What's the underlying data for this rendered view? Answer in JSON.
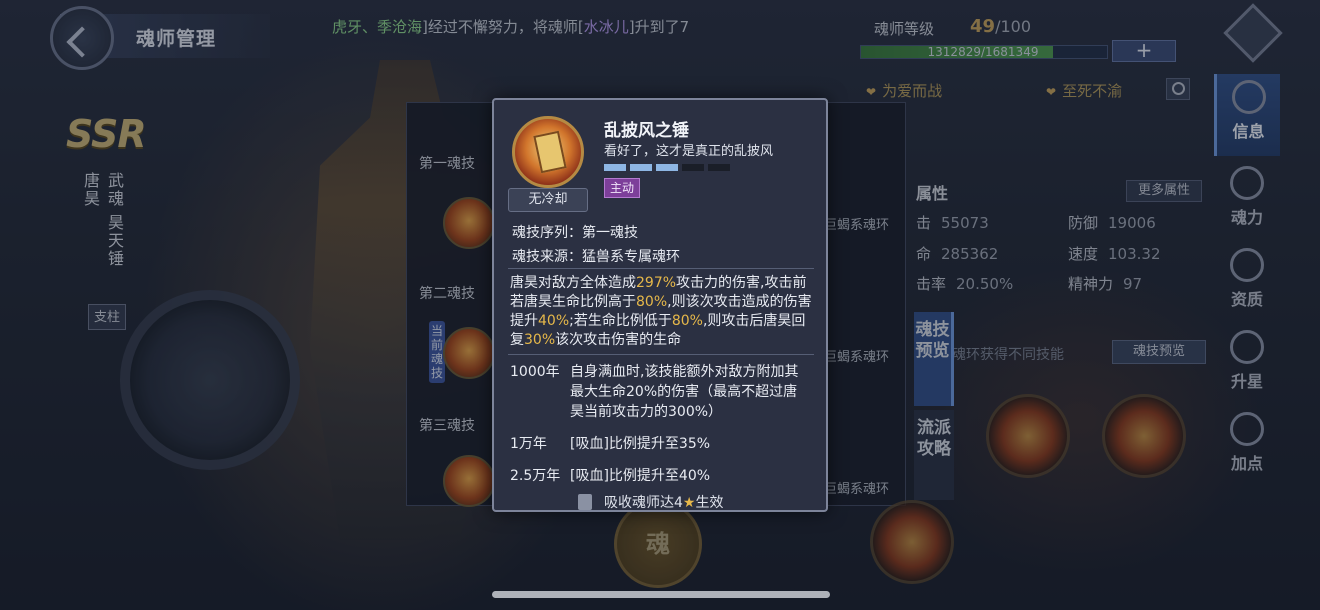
{
  "header": {
    "page_title": "魂师管理",
    "ticker": {
      "names": "虎牙、季沧海",
      "mid": "]经过不懈努力，将魂师[",
      "hero": "水冰儿",
      "tail": "]升到了7"
    },
    "level": {
      "label": "魂师等级",
      "current": "49",
      "max": "/100",
      "exp_text": "1312829/1681349",
      "exp_fraction": 0.781,
      "add_label": "+"
    },
    "titles": [
      "为爱而战",
      "至死不渝"
    ]
  },
  "hero": {
    "rarity": "SSR",
    "name": "唐昊",
    "spirit_label": "武魂",
    "spirit": "昊天锤",
    "role": "支柱"
  },
  "nav": {
    "items": [
      {
        "label": "信息",
        "icon": "info-icon",
        "active": true
      },
      {
        "label": "魂力",
        "icon": "soul-power-icon",
        "active": false
      },
      {
        "label": "资质",
        "icon": "aptitude-icon",
        "active": false
      },
      {
        "label": "升星",
        "icon": "star-up-icon",
        "active": false
      },
      {
        "label": "加点",
        "icon": "add-point-icon",
        "active": false
      }
    ]
  },
  "skills_panel": {
    "slots": [
      "第一魂技",
      "第二魂技",
      "第三魂技"
    ],
    "current_tag": "当前魂技",
    "ring_labels": [
      "巨蝎系魂环",
      "巨蝎系魂环",
      "巨蝎系魂环"
    ]
  },
  "stats": {
    "title": "属性",
    "more_label": "更多属性",
    "items": [
      {
        "label": "击",
        "value": "55073"
      },
      {
        "label": "防御",
        "value": "19006"
      },
      {
        "label": "命",
        "value": "285362"
      },
      {
        "label": "速度",
        "value": "103.32"
      },
      {
        "label": "击率",
        "value": "20.50%"
      },
      {
        "label": "精神力",
        "value": "97"
      }
    ],
    "hint": "魂环获得不同技能",
    "preview_label": "魂技预览",
    "tab_preview": "魂技预览",
    "tab_school": "流派攻略",
    "soul_btn": "魂"
  },
  "popup": {
    "skill_name": "乱披风之锤",
    "quote": "看好了，这才是真正的乱披风",
    "level_pips_on": 3,
    "level_pips_total": 5,
    "skill_type": "主动",
    "cooldown": "无冷却",
    "order_label": "魂技序列：",
    "order_value": "第一魂技",
    "source_label": "魂技来源：",
    "source_value": "猛兽系专属魂环",
    "desc": {
      "p1": "唐昊对敌方全体造成",
      "v1": "297%",
      "p2": "攻击力的伤害,攻击前若唐昊生命比例高于",
      "v2": "80%",
      "p3": ",则该次攻击造成的伤害提升",
      "v3": "40%",
      "p4": ";若生命比例低于",
      "v4": "80%",
      "p5": ",则攻击后唐昊回复",
      "v5": "30%",
      "p6": "该次攻击伤害的生命"
    },
    "upgrades": [
      {
        "tier": "1000年",
        "text": "自身满血时,该技能额外对敌方附加其最大生命20%的伤害（最高不超过唐昊当前攻击力的300%）"
      },
      {
        "tier": "1万年",
        "text": "[吸血]比例提升至35%"
      },
      {
        "tier": "2.5万年",
        "text": "[吸血]比例提升至40%"
      }
    ],
    "absorb_text": "吸收魂师达4",
    "absorb_tail": "生效"
  },
  "colors": {
    "accent_gold": "#e6b84a",
    "active_tab": "#34508a",
    "skill_type_purple": "#7d3f9a",
    "pip_on": "#8eb6e4"
  }
}
